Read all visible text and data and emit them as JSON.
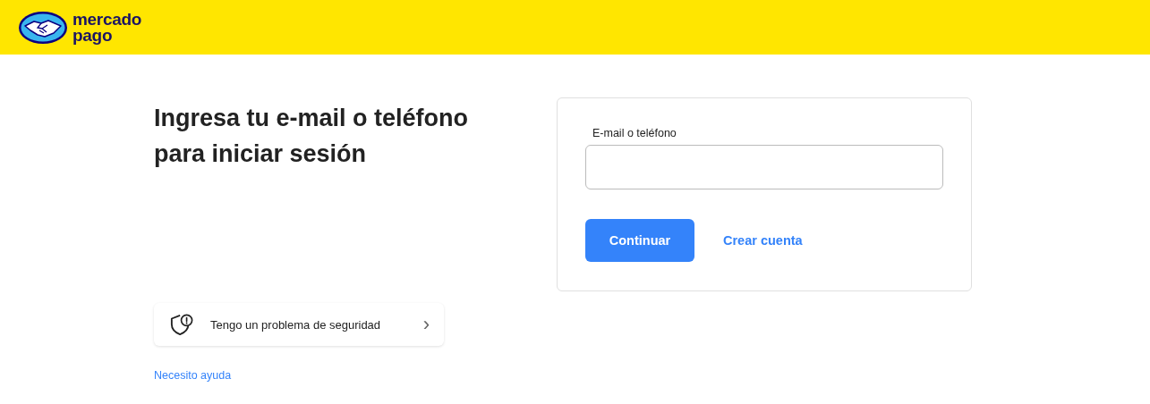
{
  "header": {
    "logo": {
      "line_1": "mercado",
      "line_2": "pago"
    }
  },
  "heading": "Ingresa tu e-mail o teléfono para iniciar sesión",
  "security_item": {
    "label": "Tengo un problema de seguridad",
    "chevron": "›"
  },
  "help_link": "Necesito ayuda",
  "login_form": {
    "field_label": "E-mail o teléfono",
    "continue_button": "Continuar",
    "create_account_link": "Crear cuenta"
  }
}
